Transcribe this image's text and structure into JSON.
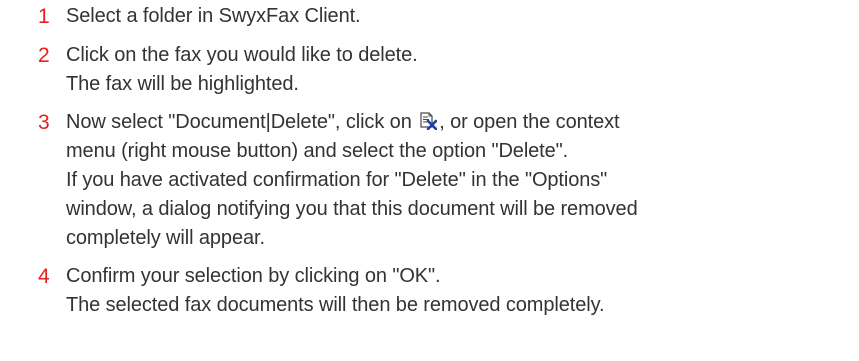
{
  "steps": [
    {
      "number": "1",
      "lines": [
        "Select a folder in SwyxFax Client."
      ]
    },
    {
      "number": "2",
      "lines": [
        "Click on the fax you would like to delete.",
        "The fax will be highlighted."
      ]
    },
    {
      "number": "3",
      "line1_before_icon": "Now select \"Document|Delete\", click on",
      "line1_after_icon": ", or open the context",
      "icon": "delete-document-icon",
      "lines_after": [
        "menu (right mouse button) and select the option \"Delete\".",
        "If you have activated confirmation for \"Delete\" in the \"Options\"",
        "window, a dialog notifying you that this document will be removed",
        "completely will appear."
      ]
    },
    {
      "number": "4",
      "lines": [
        "Confirm your selection by clicking on \"OK\".",
        "The selected fax documents will then be removed completely."
      ]
    }
  ],
  "colors": {
    "step_number": "#e4211d",
    "text": "#333333",
    "icon_x": "#1e3fa8"
  }
}
